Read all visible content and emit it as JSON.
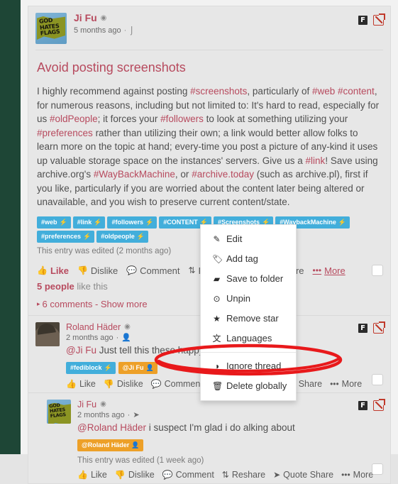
{
  "post": {
    "author": "Ji Fu",
    "author_badge_icon": "globe-icon",
    "timestamp": "5 months ago",
    "meta_sep": "·",
    "meta_icon": "pin-icon",
    "network_icon_label": "F",
    "external_icon": "open-external-icon",
    "title": "Avoid posting screenshots",
    "body_segments": [
      {
        "t": "I highly recommend against posting ",
        "tag": false
      },
      {
        "t": "#screenshots",
        "tag": true
      },
      {
        "t": ", particularly of ",
        "tag": false
      },
      {
        "t": "#web",
        "tag": true
      },
      {
        "t": " ",
        "tag": false
      },
      {
        "t": "#content",
        "tag": true
      },
      {
        "t": ", for numerous reasons, including but not limited to: It's hard to read, especially for us ",
        "tag": false
      },
      {
        "t": "#oldPeople",
        "tag": true
      },
      {
        "t": "; it forces your ",
        "tag": false
      },
      {
        "t": "#followers",
        "tag": true
      },
      {
        "t": " to look at something utilizing your ",
        "tag": false
      },
      {
        "t": "#preferences",
        "tag": true
      },
      {
        "t": " rather than utilizing their own; a link would better allow folks to learn more on the topic at hand; every-time you post a picture of any-kind it uses up valuable storage space on the instances' servers. Give us a ",
        "tag": false
      },
      {
        "t": "#link",
        "tag": true
      },
      {
        "t": "! Save using archive.org's ",
        "tag": false
      },
      {
        "t": "#WayBackMachine",
        "tag": true
      },
      {
        "t": ", or ",
        "tag": false
      },
      {
        "t": "#archive.today",
        "tag": true
      },
      {
        "t": " (such as archive.pl), first if you like, particularly if you are worried about the content later being altered or unavailable, and you wish to preserve current content/state.",
        "tag": false
      }
    ],
    "tags": [
      "#web",
      "#link",
      "#followers",
      "#CONTENT",
      "#Screenshots",
      "#WaybackMachine",
      "#preferences",
      "#oldpeople"
    ],
    "tag_glyph": "⚡",
    "edited_note": "This entry was edited (2 months ago)",
    "likes_count": "5 people",
    "likes_suffix": "like this",
    "comments_toggle": "6 comments - Show more",
    "comments_caret": "▸"
  },
  "actions": {
    "like": "Like",
    "dislike": "Dislike",
    "comment": "Comment",
    "reshare": "Reshare",
    "quote_share": "Quote Share",
    "more": "More",
    "more_dots": "•••",
    "like_icon": "thumbs-up-icon",
    "dislike_icon": "thumbs-down-icon",
    "comment_icon": "speech-bubble-icon",
    "reshare_icon": "retweet-icon",
    "quote_icon": "share-arrow-icon"
  },
  "dropdown": {
    "items": [
      {
        "label": "Edit",
        "icon": "pencil-icon",
        "glyph": "✎"
      },
      {
        "label": "Add tag",
        "icon": "tag-icon",
        "glyph": "🏷"
      },
      {
        "label": "Save to folder",
        "icon": "folder-icon",
        "glyph": "▰"
      },
      {
        "label": "Unpin",
        "icon": "unpin-icon",
        "glyph": "⊙"
      },
      {
        "label": "Remove star",
        "icon": "star-icon",
        "glyph": "★"
      },
      {
        "label": "Languages",
        "icon": "languages-icon",
        "glyph": "文"
      },
      {
        "label": "Ignore thread",
        "icon": "eye-slash-icon",
        "glyph": "◑"
      },
      {
        "label": "Delete globally",
        "icon": "trash-icon",
        "glyph": "🗑"
      }
    ],
    "separator_after_index": 5
  },
  "comments": [
    {
      "author": "Roland Häder",
      "author_badge_icon": "globe-icon",
      "timestamp": "2 months ago",
      "meta_icon": "user-icon",
      "text_mention": "@Ji Fu",
      "text_rest": " Just tell this these happy blocking",
      "pills": [
        {
          "label": "#fediblock",
          "kind": "tag",
          "glyph": "⚡"
        },
        {
          "label": "@Ji Fu",
          "kind": "mention",
          "glyph": "👤"
        }
      ],
      "avatar": "person",
      "network_icon_label": "F",
      "has_checkbox": true
    },
    {
      "author": "Ji Fu",
      "author_badge_icon": "globe-icon",
      "timestamp": "2 months ago",
      "meta_icon": "send-icon",
      "text_mention": "@Roland Häder",
      "text_rest": " i suspect I'm glad i do            alking about",
      "pills": [
        {
          "label": "@Roland Häder",
          "kind": "mention",
          "glyph": "👤"
        }
      ],
      "edited_note": "This entry was edited (1 week ago)",
      "avatar": "flag",
      "network_icon_label": "F",
      "has_checkbox": true
    }
  ],
  "avatar_flag_text": "GOD HATES FLAGS",
  "annotation": {
    "shape": "ellipse",
    "color": "#e8191b",
    "targets": "Ignore thread"
  },
  "colors": {
    "accent": "#b74a5e",
    "tag_pill": "#42aedb",
    "mention_pill": "#eda028",
    "rail": "#1e4636",
    "card_bg": "#e7e7e7"
  }
}
